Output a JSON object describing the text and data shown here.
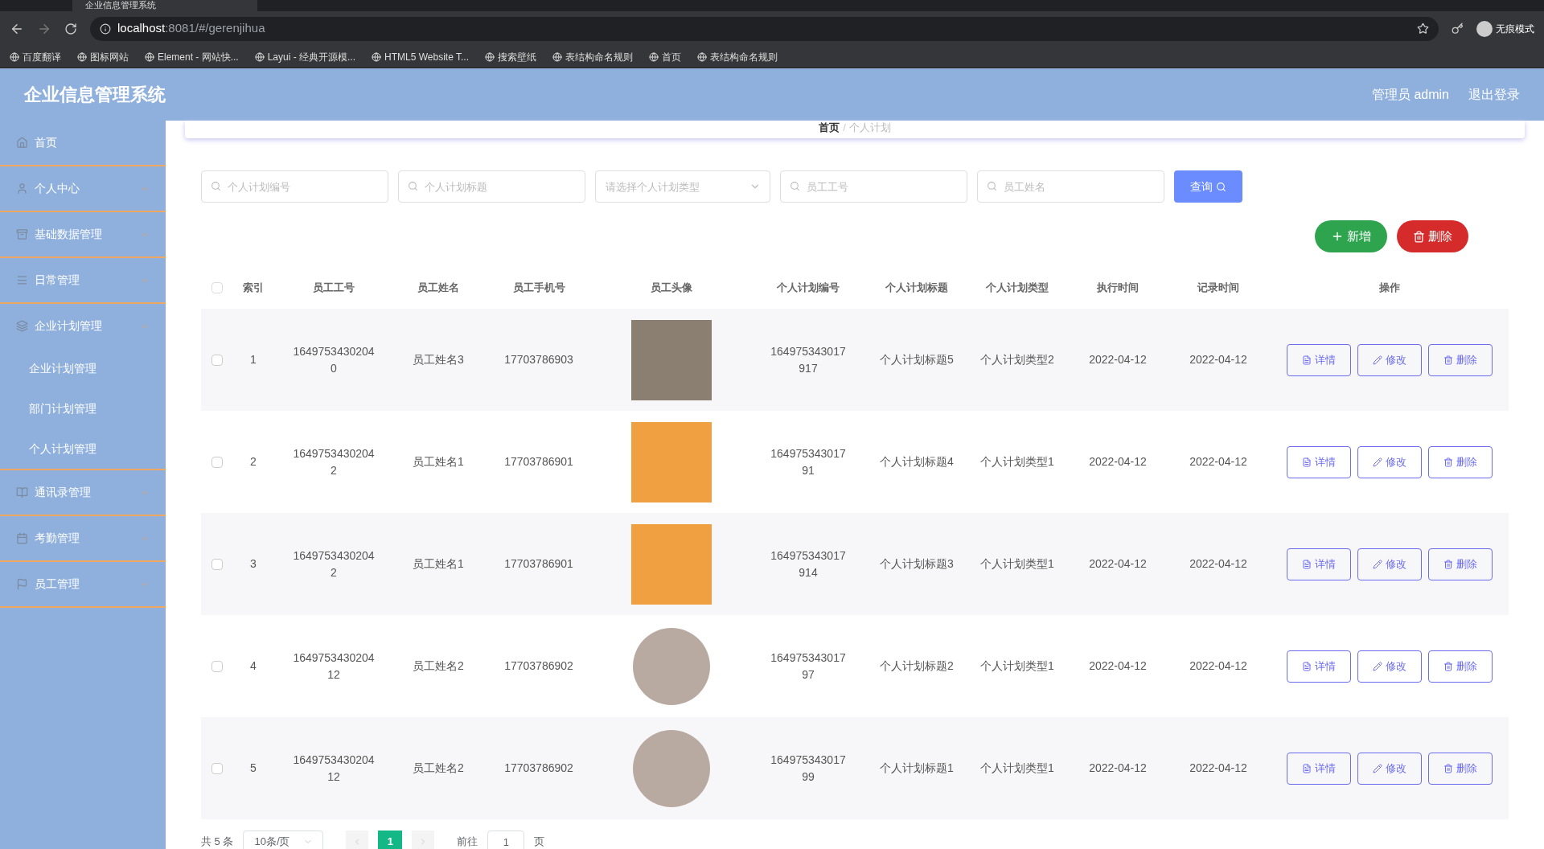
{
  "browser": {
    "tab_title": "企业信息管理系统",
    "url_host": "localhost",
    "url_rest": ":8081/#/gerenjihua",
    "profile": "无痕模式",
    "bookmarks": [
      "百度翻译",
      "图标网站",
      "Element - 网站快...",
      "Layui - 经典开源模...",
      "HTML5 Website T...",
      "搜索壁纸",
      "表结构命名规则",
      "首页",
      "表结构命名规则"
    ]
  },
  "header": {
    "title": "企业信息管理系统",
    "user": "管理员 admin",
    "logout": "退出登录"
  },
  "sidebar": {
    "items": [
      {
        "label": "首页",
        "kind": "main"
      },
      {
        "label": "个人中心",
        "kind": "group",
        "expanded": false
      },
      {
        "label": "基础数据管理",
        "kind": "group",
        "expanded": false
      },
      {
        "label": "日常管理",
        "kind": "group",
        "expanded": false
      },
      {
        "label": "企业计划管理",
        "kind": "group",
        "expanded": true,
        "children": [
          {
            "label": "企业计划管理"
          },
          {
            "label": "部门计划管理"
          },
          {
            "label": "个人计划管理"
          }
        ]
      },
      {
        "label": "通讯录管理",
        "kind": "group",
        "expanded": false
      },
      {
        "label": "考勤管理",
        "kind": "group",
        "expanded": false
      },
      {
        "label": "员工管理",
        "kind": "group",
        "expanded": false
      }
    ]
  },
  "breadcrumb": {
    "items": [
      "首页",
      "个人计划"
    ],
    "separator": "/"
  },
  "filters": [
    {
      "kind": "text",
      "placeholder": "个人计划编号"
    },
    {
      "kind": "text",
      "placeholder": "个人计划标题"
    },
    {
      "kind": "select",
      "placeholder": "请选择个人计划类型"
    },
    {
      "kind": "text",
      "placeholder": "员工工号"
    },
    {
      "kind": "text",
      "placeholder": "员工姓名"
    }
  ],
  "search_button": "查询",
  "add_button": "新增",
  "delete_button": "删除",
  "table": {
    "select_all_checked": false,
    "columns": [
      "索引",
      "员工工号",
      "员工姓名",
      "员工手机号",
      "员工头像",
      "个人计划编号",
      "个人计划标题",
      "个人计划类型",
      "执行时间",
      "记录时间",
      "操作"
    ],
    "rows": [
      {
        "checked": false,
        "index": "1",
        "id_lines": [
          "1649753430204",
          "0"
        ],
        "name": "员工姓名3",
        "phone": "17703786903",
        "avatar": {
          "kind": "photo"
        },
        "plan_lines": [
          "164975343017",
          "917"
        ],
        "title": "个人计划标题5",
        "type": "个人计划类型2",
        "exec": "2022-04-12",
        "rec": "2022-04-12",
        "actions": [
          "详情",
          "修改",
          "删除"
        ]
      },
      {
        "checked": false,
        "index": "2",
        "id_lines": [
          "1649753430204",
          "2"
        ],
        "name": "员工姓名1",
        "phone": "17703786901",
        "avatar": {
          "kind": "cartoon"
        },
        "plan_lines": [
          "164975343017",
          "91"
        ],
        "title": "个人计划标题4",
        "type": "个人计划类型1",
        "exec": "2022-04-12",
        "rec": "2022-04-12",
        "actions": [
          "详情",
          "修改",
          "删除"
        ]
      },
      {
        "checked": false,
        "index": "3",
        "id_lines": [
          "1649753430204",
          "2"
        ],
        "name": "员工姓名1",
        "phone": "17703786901",
        "avatar": {
          "kind": "cartoon"
        },
        "plan_lines": [
          "164975343017",
          "914"
        ],
        "title": "个人计划标题3",
        "type": "个人计划类型1",
        "exec": "2022-04-12",
        "rec": "2022-04-12",
        "actions": [
          "详情",
          "修改",
          "删除"
        ]
      },
      {
        "checked": false,
        "index": "4",
        "id_lines": [
          "1649753430204",
          "12"
        ],
        "name": "员工姓名2",
        "phone": "17703786902",
        "avatar": {
          "kind": "portrait"
        },
        "plan_lines": [
          "164975343017",
          "97"
        ],
        "title": "个人计划标题2",
        "type": "个人计划类型1",
        "exec": "2022-04-12",
        "rec": "2022-04-12",
        "actions": [
          "详情",
          "修改",
          "删除"
        ]
      },
      {
        "checked": false,
        "index": "5",
        "id_lines": [
          "1649753430204",
          "12"
        ],
        "name": "员工姓名2",
        "phone": "17703786902",
        "avatar": {
          "kind": "portrait"
        },
        "plan_lines": [
          "164975343017",
          "99"
        ],
        "title": "个人计划标题1",
        "type": "个人计划类型1",
        "exec": "2022-04-12",
        "rec": "2022-04-12",
        "actions": [
          "详情",
          "修改",
          "删除"
        ]
      }
    ]
  },
  "pagination": {
    "total": "共 5 条",
    "page_size": "10条/页",
    "pages": [
      {
        "label": "1",
        "selected": true
      }
    ],
    "goto": "前往",
    "goto_value": "1",
    "page_unit": "页"
  }
}
